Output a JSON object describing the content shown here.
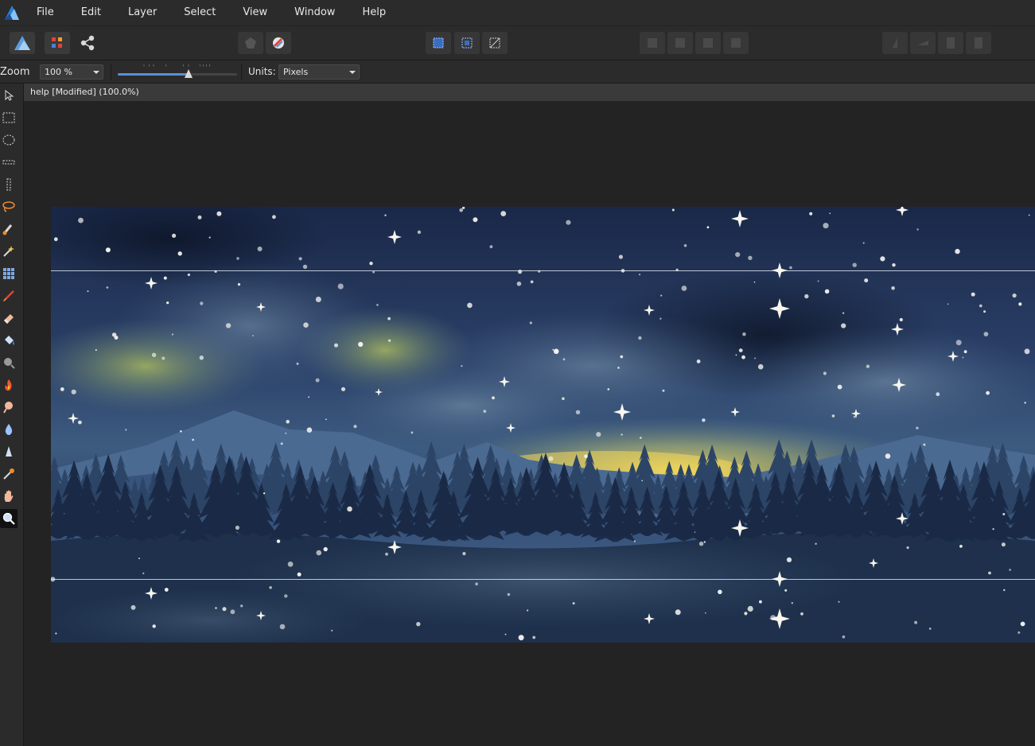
{
  "menu": {
    "items": [
      "File",
      "Edit",
      "Layer",
      "Select",
      "View",
      "Window",
      "Help"
    ]
  },
  "context_bar": {
    "zoom_label": "Zoom",
    "zoom_value": "100 %",
    "units_label": "Units:",
    "units_value": "Pixels",
    "zoom_slider_fraction": 0.59
  },
  "document": {
    "tab_title": "help [Modified] (100.0%)"
  },
  "colors": {
    "accent": "#5a8fd6",
    "sky_dark": "#1b2a48",
    "glow_yellow": "#f1d35a"
  }
}
